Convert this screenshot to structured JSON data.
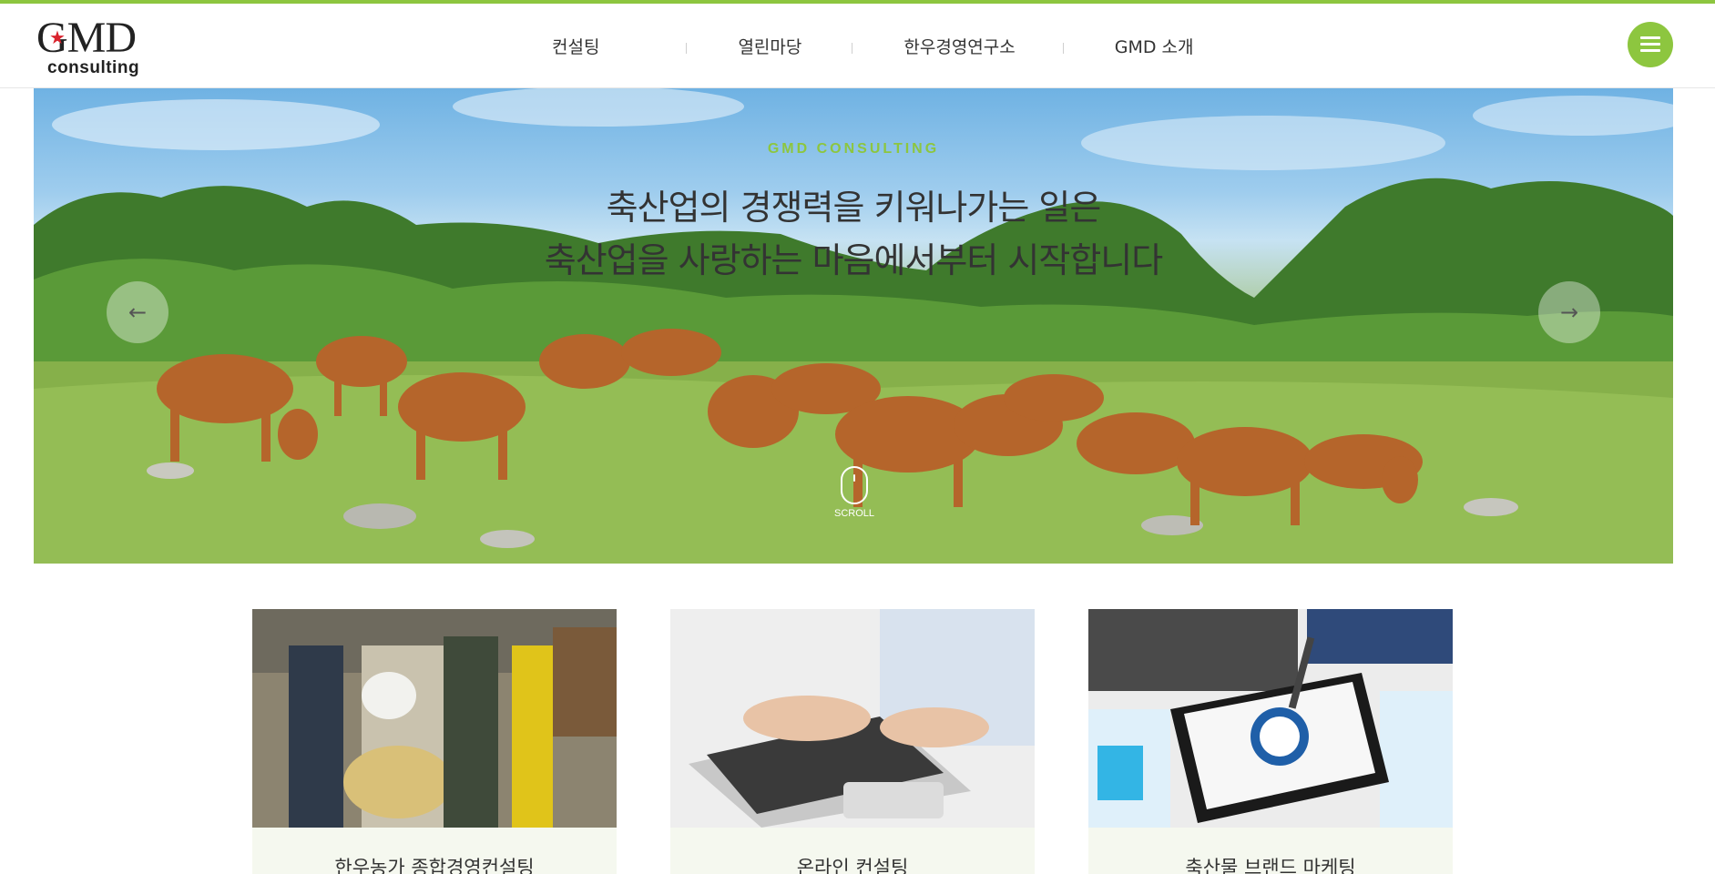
{
  "brand": {
    "logo_main": "GMD",
    "logo_sub": "consulting",
    "accent_color": "#8dc63f"
  },
  "nav": {
    "items": [
      {
        "label": "컨설팅"
      },
      {
        "label": "열린마당"
      },
      {
        "label": "한우경영연구소"
      },
      {
        "label": "GMD 소개"
      }
    ],
    "menu_icon": "hamburger-icon"
  },
  "hero": {
    "eyebrow": "GMD CONSULTING",
    "line1": "축산업의 경쟁력을 키워나가는 일은",
    "line2": "축산업을 사랑하는 마음에서부터 시작합니다",
    "prev_icon": "arrow-left-icon",
    "next_icon": "arrow-right-icon",
    "scroll_label": "SCROLL",
    "scroll_icon": "mouse-icon"
  },
  "cards": [
    {
      "title": "한우농가 종합경영컨설팅"
    },
    {
      "title": "온라인 컨설팅"
    },
    {
      "title": "축산물 브랜드 마케팅"
    }
  ]
}
